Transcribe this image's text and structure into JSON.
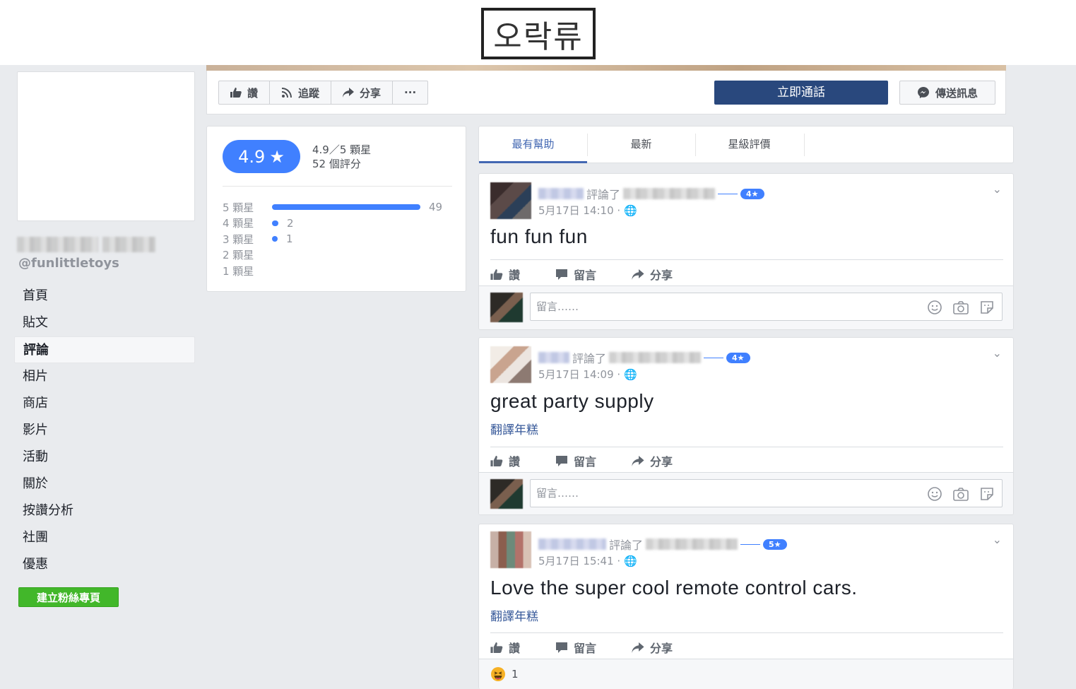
{
  "overlay": {
    "label": "오락류"
  },
  "sidebar": {
    "handle": "@funlittletoys",
    "nav": [
      {
        "label": "首頁",
        "active": false
      },
      {
        "label": "貼文",
        "active": false
      },
      {
        "label": "評論",
        "active": true
      },
      {
        "label": "相片",
        "active": false
      },
      {
        "label": "商店",
        "active": false
      },
      {
        "label": "影片",
        "active": false
      },
      {
        "label": "活動",
        "active": false
      },
      {
        "label": "關於",
        "active": false
      },
      {
        "label": "按讚分析",
        "active": false
      },
      {
        "label": "社團",
        "active": false
      },
      {
        "label": "優惠",
        "active": false
      }
    ],
    "create_button": "建立粉絲專頁"
  },
  "actionbar": {
    "like": "讚",
    "follow": "追蹤",
    "share": "分享",
    "more": "···",
    "call": "立即通話",
    "message": "傳送訊息"
  },
  "rating": {
    "score": "4.9",
    "star": "★",
    "summary_line1": "4.9／5 顆星",
    "summary_line2": "52 個評分",
    "rows": [
      {
        "label": "5 顆星",
        "count": "49",
        "fraction": 0.9423
      },
      {
        "label": "4 顆星",
        "count": "2",
        "fraction": 0.0385
      },
      {
        "label": "3 顆星",
        "count": "1",
        "fraction": 0.0192
      },
      {
        "label": "2 顆星",
        "count": "",
        "fraction": 0
      },
      {
        "label": "1 顆星",
        "count": "",
        "fraction": 0
      }
    ]
  },
  "tabs": [
    {
      "label": "最有幫助",
      "active": true
    },
    {
      "label": "最新",
      "active": false
    },
    {
      "label": "星級評價",
      "active": false
    }
  ],
  "reviews": [
    {
      "reviewed": "評論了",
      "stars": "4★",
      "time": "5月17日 14:10 ·",
      "text": "fun fun fun",
      "translate": "",
      "like": "讚",
      "comment": "留言",
      "share": "分享",
      "comment_placeholder": "留言……"
    },
    {
      "reviewed": "評論了",
      "stars": "4★",
      "time": "5月17日 14:09 ·",
      "text": "great party supply",
      "translate": "翻譯年糕",
      "like": "讚",
      "comment": "留言",
      "share": "分享",
      "comment_placeholder": "留言……"
    },
    {
      "reviewed": "評論了",
      "stars": "5★",
      "time": "5月17日 15:41 ·",
      "text": "Love the super cool remote control cars.",
      "translate": "翻譯年糕",
      "like": "讚",
      "comment": "留言",
      "share": "分享",
      "reaction_count": "1"
    }
  ],
  "colors": {
    "accent": "#4080ff",
    "call_button": "#29487d",
    "create_button": "#42b72a",
    "link": "#365899"
  }
}
